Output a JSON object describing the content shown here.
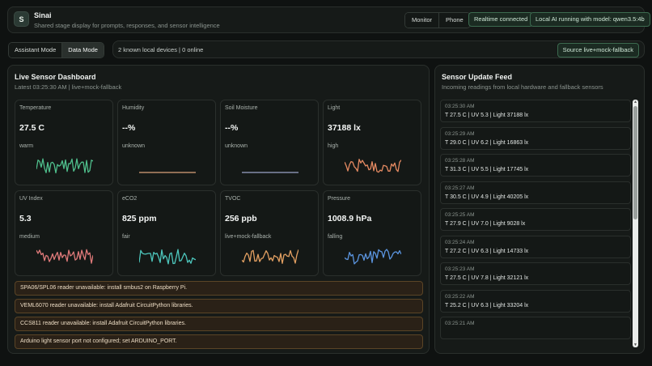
{
  "app": {
    "logo_letter": "S",
    "title": "Sinai",
    "subtitle": "Shared stage display for prompts, responses, and sensor intelligence"
  },
  "view_toggle": [
    {
      "label": "Monitor",
      "active": false
    },
    {
      "label": "Phone",
      "active": false
    }
  ],
  "status": {
    "realtime": "Realtime connected",
    "local_ai": "Local AI running with model: qwen3.5:4b"
  },
  "mode_toggle": [
    {
      "label": "Assistant Mode",
      "active": false
    },
    {
      "label": "Data Mode",
      "active": true
    }
  ],
  "devices": {
    "summary": "2 known local devices | 0 online",
    "source": "Source live+mock-fallback"
  },
  "dashboard": {
    "title": "Live Sensor Dashboard",
    "subtitle": "Latest 03:25:30 AM | live+mock-fallback",
    "cards": [
      {
        "label": "Temperature",
        "value": "27.5 C",
        "state": "warm",
        "spark_color": "#4fbf8c",
        "flat": false
      },
      {
        "label": "Humidity",
        "value": "--%",
        "state": "unknown",
        "spark_color": "#d9a27a",
        "flat": true
      },
      {
        "label": "Soil Moisture",
        "value": "--%",
        "state": "unknown",
        "spark_color": "#9aa3c8",
        "flat": true
      },
      {
        "label": "Light",
        "value": "37188 lx",
        "state": "high",
        "spark_color": "#e58a62",
        "flat": false
      },
      {
        "label": "UV Index",
        "value": "5.3",
        "state": "medium",
        "spark_color": "#e07a7a",
        "flat": false
      },
      {
        "label": "eCO2",
        "value": "825 ppm",
        "state": "fair",
        "spark_color": "#4dc7bd",
        "flat": false
      },
      {
        "label": "TVOC",
        "value": "256 ppb",
        "state": "live+mock-fallback",
        "spark_color": "#e3a062",
        "flat": false
      },
      {
        "label": "Pressure",
        "value": "1008.9 hPa",
        "state": "falling",
        "spark_color": "#5b95e0",
        "flat": false
      }
    ],
    "warnings": [
      "SPA06/SPL06 reader unavailable: install smbus2 on Raspberry Pi.",
      "VEML6070 reader unavailable: install Adafruit CircuitPython libraries.",
      "CCS811 reader unavailable: install Adafruit CircuitPython libraries.",
      "Arduino light sensor port not configured; set ARDUINO_PORT."
    ]
  },
  "feed": {
    "title": "Sensor Update Feed",
    "subtitle": "Incoming readings from local hardware and fallback sensors",
    "items": [
      {
        "time": "03:25:30 AM",
        "reading": "T 27.5 C | UV 5.3 | Light 37188 lx"
      },
      {
        "time": "03:25:29 AM",
        "reading": "T 29.0 C | UV 6.2 | Light 16863 lx"
      },
      {
        "time": "03:25:28 AM",
        "reading": "T 31.3 C | UV 5.5 | Light 17745 lx"
      },
      {
        "time": "03:25:27 AM",
        "reading": "T 30.5 C | UV 4.9 | Light 40205 lx"
      },
      {
        "time": "03:25:25 AM",
        "reading": "T 27.9 C | UV 7.0 | Light 9028 lx"
      },
      {
        "time": "03:25:24 AM",
        "reading": "T 27.2 C | UV 6.3 | Light 14733 lx"
      },
      {
        "time": "03:25:23 AM",
        "reading": "T 27.5 C | UV 7.8 | Light 32121 lx"
      },
      {
        "time": "03:25:22 AM",
        "reading": "T 25.2 C | UV 6.3 | Light 33204 lx"
      },
      {
        "time": "03:25:21 AM",
        "reading": ""
      }
    ]
  }
}
